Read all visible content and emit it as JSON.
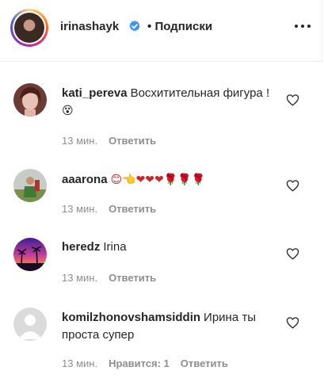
{
  "post": {
    "username": "irinashayk",
    "follow_separator": "•",
    "follow_label": "Подписки"
  },
  "comments": [
    {
      "username": "kati_pereva",
      "text": "Восхитительная фигура !",
      "emoji": "😵",
      "time": "13 мин.",
      "reply_label": "Ответить"
    },
    {
      "username": "aaarona",
      "text": "",
      "emoji": "😊👈❤❤❤🌹🌹🌹",
      "time": "13 мин.",
      "reply_label": "Ответить"
    },
    {
      "username": "heredz",
      "text": "Irina",
      "emoji": "",
      "time": "13 мин.",
      "reply_label": "Ответить"
    },
    {
      "username": "komilzhonovshamsiddin",
      "text": "Ирина ты проста супер",
      "emoji": "",
      "time": "13 мин.",
      "likes_label": "Нравится: 1",
      "reply_label": "Ответить"
    }
  ],
  "colors": {
    "text": "#262626",
    "meta": "#8e8e8e",
    "verified": "#3897f0",
    "divider": "#efefef"
  }
}
